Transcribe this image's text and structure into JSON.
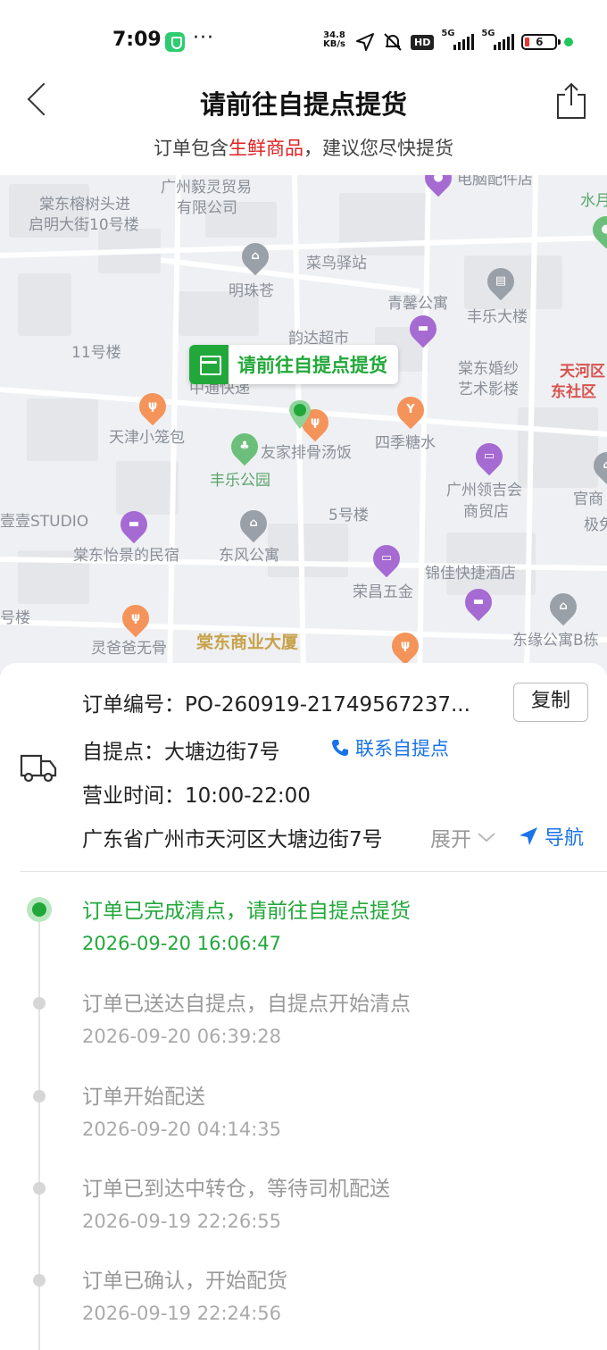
{
  "status_bar": {
    "time": "7:09",
    "net_speed_value": "34.8",
    "net_speed_unit": "KB/s",
    "hd_badge": "HD",
    "signal1_label": "5G",
    "signal2_label": "5G",
    "battery": "6"
  },
  "header": {
    "title": "请前往自提点提货",
    "subtitle_prefix": "订单包含",
    "subtitle_highlight": "生鲜商品",
    "subtitle_suffix": "，建议您尽快提货"
  },
  "map": {
    "callout": "请前往自提点提货",
    "labels": {
      "l1": "棠东榕树头进",
      "l2": "启明大街10号楼",
      "l3": "广州毅灵贸易",
      "l4": "有限公司",
      "l5": "电脑配件店",
      "l6": "水月",
      "l7": "菜鸟驿站",
      "l8": "明珠苍",
      "l9": "青馨公寓",
      "l10": "丰乐大楼",
      "l11": "韵达超市",
      "l12": "11号楼",
      "l13": "中通快递",
      "l14": "棠东婚纱",
      "l15": "艺术影楼",
      "l16": "天河区",
      "l17": "东社区",
      "l18": "天津小笼包",
      "l19": "友家排骨汤饭",
      "l20": "四季糖水",
      "l21": "丰乐公园",
      "l22": "广州领吉会",
      "l23": "商贸店",
      "l24": "官商",
      "l25": "极兔",
      "l26": "壹壹STUDIO",
      "l27": "5号楼",
      "l28": "棠东怡景的民宿",
      "l29": "东风公寓",
      "l30": "锦佳快捷酒店",
      "l31": "荣昌五金",
      "l32": "号楼",
      "l33": "灵爸爸无骨",
      "l34": "棠东商业大厦",
      "l35": "东缘公寓B栋"
    }
  },
  "order": {
    "number_label": "订单编号：",
    "number_value": "PO-260919-21749567237...",
    "copy_label": "复制",
    "pickup_label": "自提点：",
    "pickup_value": "大塘边街7号",
    "contact_label": "联系自提点",
    "hours_label": "营业时间：",
    "hours_value": "10:00-22:00",
    "address": "广东省广州市天河区大塘边街7号",
    "expand_label": "展开",
    "nav_label": "导航"
  },
  "timeline": [
    {
      "title": "订单已完成清点，请前往自提点提货",
      "time": "2026-09-20 16:06:47"
    },
    {
      "title": "订单已送达自提点，自提点开始清点",
      "time": "2026-09-20 06:39:28"
    },
    {
      "title": "订单开始配送",
      "time": "2026-09-20 04:14:35"
    },
    {
      "title": "订单已到达中转仓，等待司机配送",
      "time": "2026-09-19 22:26:55"
    },
    {
      "title": "订单已确认，开始配货",
      "time": "2026-09-19 22:24:56"
    }
  ],
  "colors": {
    "accent_green": "#22a83a",
    "link_blue": "#1a73e8",
    "highlight_red": "#e02020"
  }
}
